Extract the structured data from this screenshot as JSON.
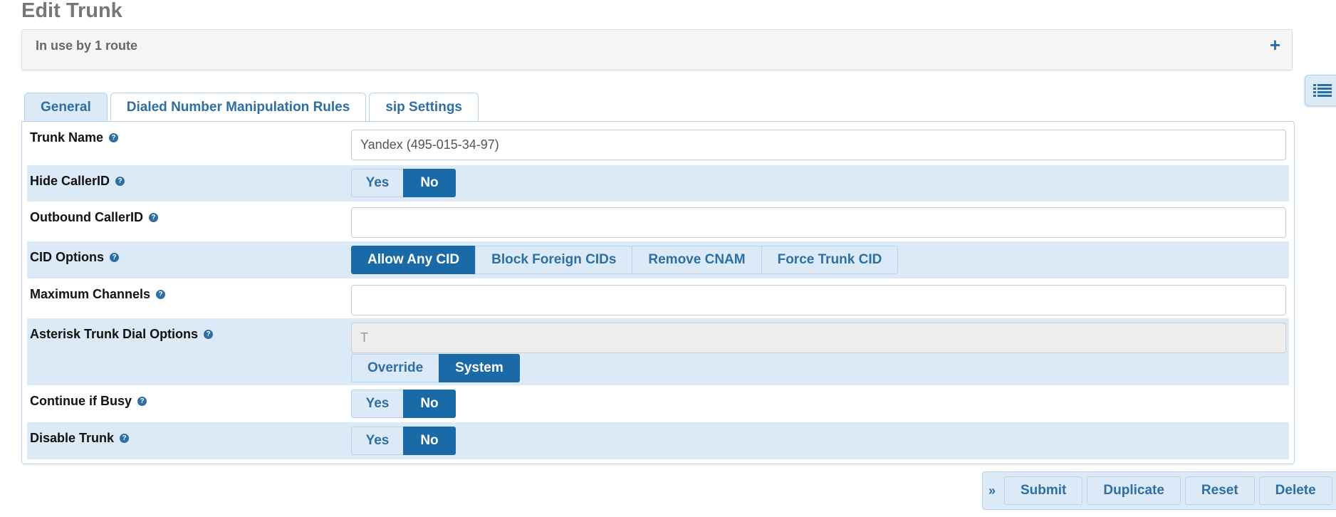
{
  "page": {
    "title": "Edit Trunk"
  },
  "usage": {
    "label": "In use by 1 route",
    "expand_symbol": "+"
  },
  "tabs": [
    {
      "label": "General"
    },
    {
      "label": "Dialed Number Manipulation Rules"
    },
    {
      "label": "sip Settings"
    }
  ],
  "fields": {
    "trunk_name": {
      "label": "Trunk Name",
      "value": "Yandex (495-015-34-97)"
    },
    "hide_callerid": {
      "label": "Hide CallerID",
      "yes": "Yes",
      "no": "No",
      "selected": "No"
    },
    "outbound_callerid": {
      "label": "Outbound CallerID",
      "value": ""
    },
    "cid_options": {
      "label": "CID Options",
      "options": [
        "Allow Any CID",
        "Block Foreign CIDs",
        "Remove CNAM",
        "Force Trunk CID"
      ],
      "selected": "Allow Any CID"
    },
    "max_channels": {
      "label": "Maximum Channels",
      "value": ""
    },
    "dial_options": {
      "label": "Asterisk Trunk Dial Options",
      "value": "T",
      "override": "Override",
      "system": "System",
      "selected": "System"
    },
    "continue_if_busy": {
      "label": "Continue if Busy",
      "yes": "Yes",
      "no": "No",
      "selected": "No"
    },
    "disable_trunk": {
      "label": "Disable Trunk",
      "yes": "Yes",
      "no": "No",
      "selected": "No"
    }
  },
  "help_symbol": "?",
  "actions": {
    "chevron": "»",
    "submit": "Submit",
    "duplicate": "Duplicate",
    "reset": "Reset",
    "delete": "Delete"
  },
  "colors": {
    "accent": "#1b6aa8",
    "link": "#2d6fa5",
    "row_shade": "#dbeaf6",
    "border": "#b5d3ea"
  }
}
